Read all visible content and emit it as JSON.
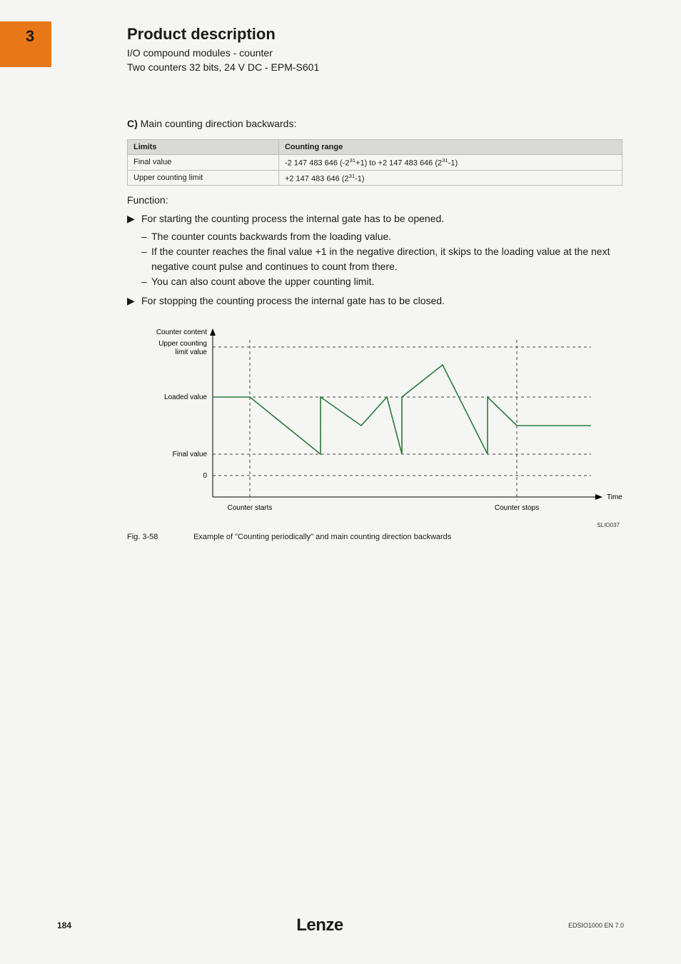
{
  "header": {
    "chapter_number": "3",
    "title": "Product description",
    "subtitle1": "I/O compound modules - counter",
    "subtitle2": "Two counters 32 bits, 24 V DC - EPM-S601"
  },
  "section_c": {
    "prefix": "C)",
    "text": " Main counting direction backwards:"
  },
  "table": {
    "headers": [
      "Limits",
      "Counting range"
    ],
    "rows": [
      {
        "limit": "Final value",
        "range_plain": "-2 147 483 646 (-2^31+1) to +2 147 483 646 (2^31-1)"
      },
      {
        "limit": "Upper counting limit",
        "range_plain": "+2 147 483 646 (2^31-1)"
      }
    ]
  },
  "function_label": "Function:",
  "bullets": {
    "b1": "For starting the counting process the internal gate has to be opened.",
    "b1_sub1": "The counter counts backwards from the loading value.",
    "b1_sub2": "If the counter reaches the final value +1 in the negative direction, it skips to the loading value at the next negative count pulse and continues to count from there.",
    "b1_sub3": "You can also count above the upper counting limit.",
    "b2": "For stopping the counting process the internal gate has to be closed."
  },
  "chart_data": {
    "type": "line",
    "title": "",
    "y_axis_label": "Counter content",
    "x_axis_label": "Time",
    "y_ticks": [
      "Upper counting limit value",
      "Loaded value",
      "Final value",
      "0"
    ],
    "x_events": [
      "Counter starts",
      "Counter stops"
    ],
    "series": [
      {
        "name": "counter_value",
        "color": "#2a7a3a",
        "description": "Piecewise waveform: before start holds at Loaded value; after start decreases toward Final value, wraps back up to Loaded value on reaching Final value (multiple cycles), with one excursion rising above Loaded value toward Upper counting limit then back down; after stop holds flat below Loaded value.",
        "points": [
          {
            "x": 0.0,
            "y": "Loaded"
          },
          {
            "x": 0.1,
            "y": "Loaded"
          },
          {
            "x": 0.29,
            "y": "Final"
          },
          {
            "x": 0.29,
            "y": "Loaded"
          },
          {
            "x": 0.4,
            "y": "midLF"
          },
          {
            "x": 0.47,
            "y": "Loaded"
          },
          {
            "x": 0.51,
            "y": "Final"
          },
          {
            "x": 0.51,
            "y": "Loaded"
          },
          {
            "x": 0.62,
            "y": "betweenLU"
          },
          {
            "x": 0.74,
            "y": "Final"
          },
          {
            "x": 0.74,
            "y": "Loaded"
          },
          {
            "x": 0.82,
            "y": "midLF"
          },
          {
            "x": 1.0,
            "y": "midLF"
          }
        ]
      }
    ],
    "reference_lines": [
      {
        "y": "Upper counting limit value",
        "style": "dashed"
      },
      {
        "y": "Loaded value",
        "style": "dashed"
      },
      {
        "y": "Final value",
        "style": "dashed"
      },
      {
        "y": "0",
        "style": "dashed"
      }
    ],
    "vertical_markers": [
      {
        "x": "Counter starts",
        "style": "dashed"
      },
      {
        "x": "Counter stops",
        "style": "dashed"
      }
    ],
    "code": "SLIO037"
  },
  "figure_caption": {
    "num": "Fig. 3-58",
    "text": "Example of \"Counting periodically\" and main counting direction backwards"
  },
  "footer": {
    "page": "184",
    "brand": "Lenze",
    "doc": "EDSIO1000 EN 7.0"
  }
}
